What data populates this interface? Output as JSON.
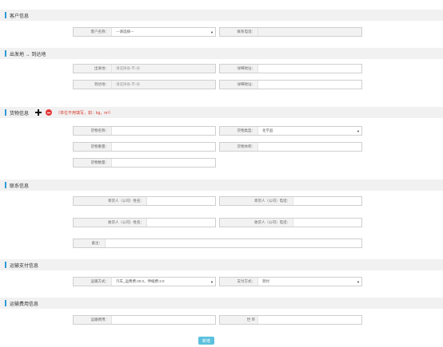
{
  "sections": {
    "customer": "客户信息",
    "route": "出发地 → 到达地",
    "cargo": "货物信息",
    "contact": "联系信息",
    "payment": "运输支付信息",
    "fee": "运输费用信息"
  },
  "cargo_note": "（单位不用填写，如：kg，m³）",
  "customer": {
    "name_label": "客户名称：",
    "name_value": "---请选择---",
    "phone_label": "联系电话："
  },
  "route": {
    "from_label": "出发地：",
    "from_placeholder": "请选择省-市-县",
    "from_addr_label": "详细地址：",
    "to_label": "到达地：",
    "to_placeholder": "请选择省-市-县",
    "to_addr_label": "详细地址："
  },
  "cargo": {
    "name_label": "货物名称：",
    "type_label": "货物类型：",
    "type_value": "化学品",
    "weight_label": "货物重量：",
    "volume_label": "货物体积：",
    "count_label": "货物数量："
  },
  "contact": {
    "sender_name_label": "寄货人（公司）姓名：",
    "sender_phone_label": "寄货人（公司）电话：",
    "receiver_name_label": "收货人（公司）姓名：",
    "receiver_phone_label": "收货人（公司）电话：",
    "remark_label": "备注："
  },
  "payment": {
    "method_label": "运输方式：",
    "method_value": "汽车_运费费:20.0，伸缩费:2.0",
    "pay_label": "支付方式：",
    "pay_value": "到付"
  },
  "fee": {
    "cost_label": "运输费用：",
    "unit_label": "世 单"
  },
  "submit_label": "新增",
  "colors": {
    "accent": "#2e9bd6",
    "button": "#5bc0de",
    "note": "#d9382b",
    "delete": "#e53a3a"
  }
}
